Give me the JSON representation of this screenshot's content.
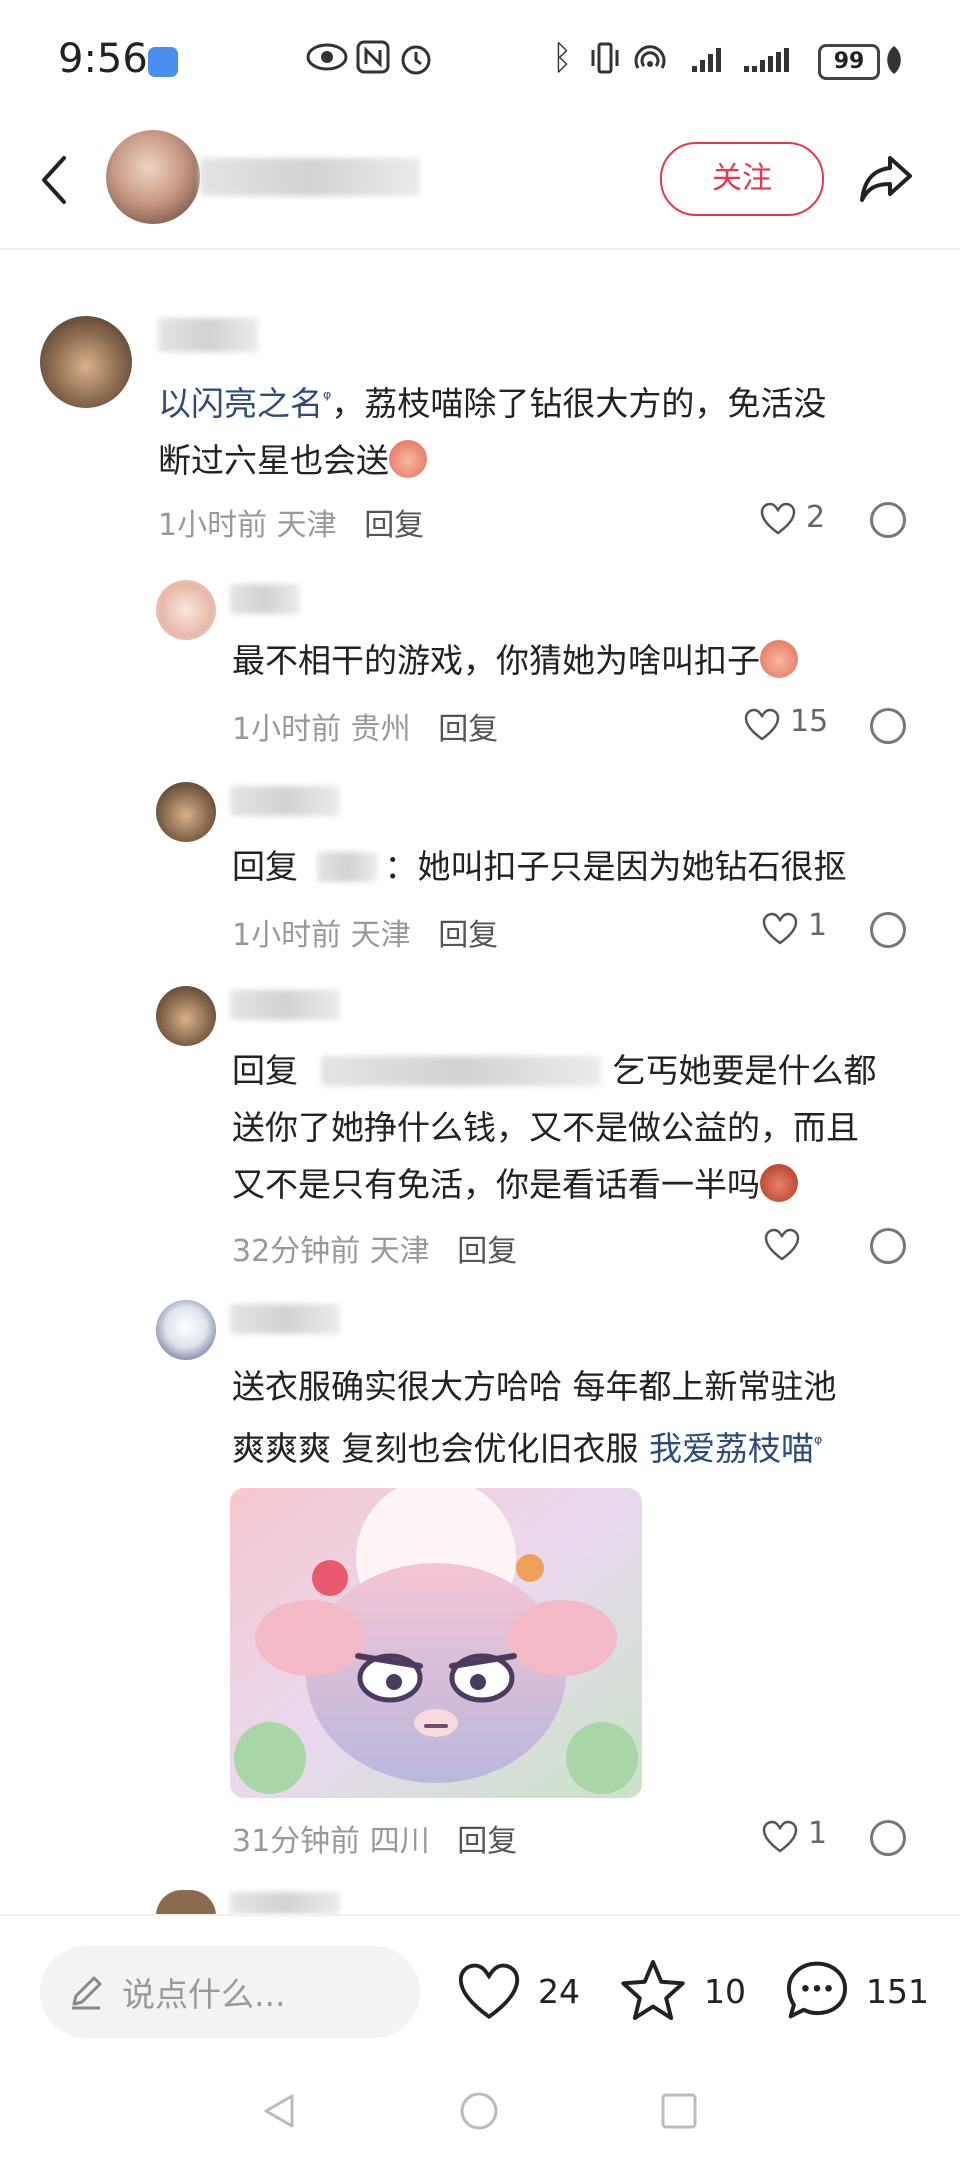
{
  "status_bar": {
    "time": "9:56",
    "battery": "99"
  },
  "header": {
    "follow_label": "关注"
  },
  "comments": [
    {
      "mention_link": "以闪亮之名",
      "text_line1": "，荔枝喵除了钻很大方的，免活没",
      "text_line2": "断过六星也会送",
      "time": "1小时前",
      "location": "天津",
      "reply_label": "回复",
      "likes": "2"
    },
    {
      "text": "最不相干的游戏，你猜她为啥叫扣子",
      "time": "1小时前",
      "location": "贵州",
      "reply_label": "回复",
      "likes": "15"
    },
    {
      "prefix": "回复",
      "text": "：她叫扣子只是因为她钻石很抠",
      "time": "1小时前",
      "location": "天津",
      "reply_label": "回复",
      "likes": "1"
    },
    {
      "prefix": "回复",
      "text_line1_end": "乞丐她要是什么都",
      "text_line2": "送你了她挣什么钱，又不是做公益的，而且",
      "text_line3": "又不是只有免活，你是看话看一半吗",
      "time": "32分钟前",
      "location": "天津",
      "reply_label": "回复",
      "likes": ""
    },
    {
      "text_line1": "送衣服确实很大方哈哈 每年都上新常驻池",
      "text_line2": "爽爽爽 复刻也会优化旧衣服",
      "link": "我爱荔枝喵",
      "time": "31分钟前",
      "location": "四川",
      "reply_label": "回复",
      "likes": "1"
    }
  ],
  "bottom_bar": {
    "input_placeholder": "说点什么...",
    "likes": "24",
    "stars": "10",
    "comments": "151"
  },
  "icons": {
    "back": "chevron-left-icon",
    "share": "share-icon",
    "heart": "heart-icon",
    "star": "star-icon",
    "comment": "comment-icon",
    "pencil": "pencil-icon",
    "emoji_reply": "emoji-reply-icon",
    "search_tag": "search-tag-icon"
  },
  "colors": {
    "accent": "#e6374d",
    "link": "#2e4a7a",
    "wifi_badge": "#4a8ef2"
  }
}
